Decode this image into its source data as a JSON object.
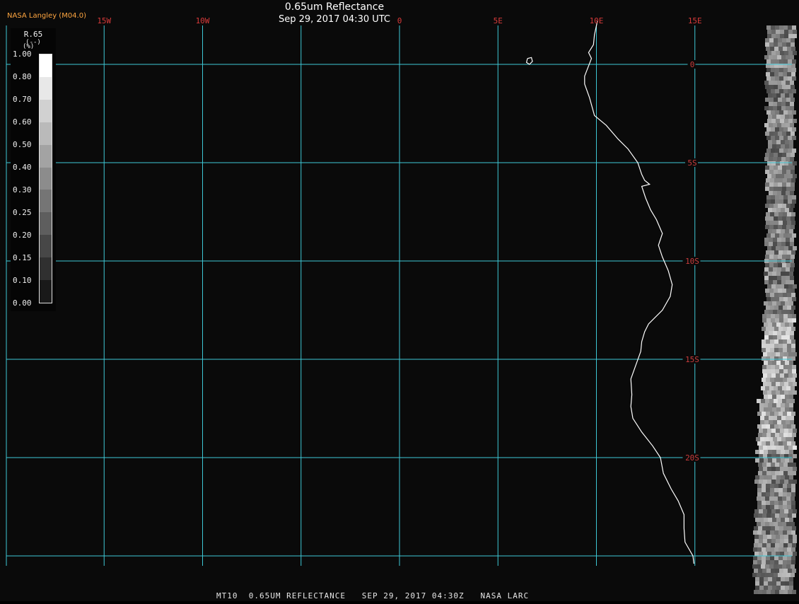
{
  "header": {
    "credit": "NASA Langley (M04.0)",
    "title": "0.65um Reflectance",
    "datetime": "Sep 29, 2017 04:30 UTC"
  },
  "footer": {
    "caption": "MT10  0.65UM REFLECTANCE   SEP 29, 2017 04:30Z   NASA LARC"
  },
  "legend": {
    "variable": "R.65",
    "units_line": "(--)",
    "units_prefix": "(%)",
    "ticks": [
      "1.00",
      "0.80",
      "0.70",
      "0.60",
      "0.50",
      "0.40",
      "0.30",
      "0.25",
      "0.20",
      "0.15",
      "0.10",
      "0.00"
    ],
    "min": 0.0,
    "max": 1.0
  },
  "map": {
    "lon_range": [
      -20,
      17
    ],
    "lat_range": [
      -25.3,
      1.9
    ],
    "lon_labels": [
      {
        "lon": -15,
        "text": "15W"
      },
      {
        "lon": -10,
        "text": "10W"
      },
      {
        "lon": -5,
        "text": ""
      },
      {
        "lon": 0,
        "text": "0"
      },
      {
        "lon": 5,
        "text": "5E"
      },
      {
        "lon": 10,
        "text": "10E"
      },
      {
        "lon": 15,
        "text": "15E"
      }
    ],
    "lat_labels": [
      {
        "lat": 0,
        "text": "0"
      },
      {
        "lat": -5,
        "text": "5S"
      },
      {
        "lat": -10,
        "text": "10S"
      },
      {
        "lat": -15,
        "text": "15S"
      },
      {
        "lat": -20,
        "text": "20S"
      },
      {
        "lat": -25,
        "text": ""
      }
    ],
    "coastline": [
      [
        10.05,
        2.2
      ],
      [
        9.9,
        1.5
      ],
      [
        9.85,
        1.0
      ],
      [
        9.6,
        0.6
      ],
      [
        9.75,
        0.3
      ],
      [
        9.4,
        -0.6
      ],
      [
        9.4,
        -1.0
      ],
      [
        9.65,
        -1.7
      ],
      [
        9.9,
        -2.6
      ],
      [
        10.5,
        -3.1
      ],
      [
        11.1,
        -3.8
      ],
      [
        11.6,
        -4.3
      ],
      [
        12.1,
        -5.0
      ],
      [
        12.3,
        -5.6
      ],
      [
        12.45,
        -5.9
      ],
      [
        12.7,
        -6.1
      ],
      [
        12.3,
        -6.2
      ],
      [
        12.5,
        -6.8
      ],
      [
        12.75,
        -7.4
      ],
      [
        13.05,
        -7.9
      ],
      [
        13.35,
        -8.6
      ],
      [
        13.15,
        -9.2
      ],
      [
        13.35,
        -9.8
      ],
      [
        13.65,
        -10.5
      ],
      [
        13.85,
        -11.2
      ],
      [
        13.75,
        -11.8
      ],
      [
        13.35,
        -12.5
      ],
      [
        12.65,
        -13.2
      ],
      [
        12.45,
        -13.6
      ],
      [
        12.3,
        -14.1
      ],
      [
        12.25,
        -14.6
      ],
      [
        12.0,
        -15.3
      ],
      [
        11.75,
        -16.0
      ],
      [
        11.8,
        -16.8
      ],
      [
        11.75,
        -17.4
      ],
      [
        11.85,
        -18.0
      ],
      [
        12.3,
        -18.7
      ],
      [
        12.85,
        -19.4
      ],
      [
        13.25,
        -20.0
      ],
      [
        13.4,
        -20.8
      ],
      [
        13.8,
        -21.6
      ],
      [
        14.15,
        -22.2
      ],
      [
        14.45,
        -22.9
      ],
      [
        14.45,
        -23.6
      ],
      [
        14.5,
        -24.3
      ],
      [
        14.9,
        -25.0
      ],
      [
        14.95,
        -25.4
      ]
    ],
    "island": [
      [
        6.5,
        0.3
      ],
      [
        6.7,
        0.35
      ],
      [
        6.75,
        0.15
      ],
      [
        6.6,
        0.0
      ],
      [
        6.45,
        0.1
      ],
      [
        6.5,
        0.3
      ]
    ]
  },
  "colors": {
    "ocean": "#0a0a0a",
    "grid": "#3ec8d6",
    "lon_label": "#d83a3a",
    "lat_label": "#c83c3c",
    "coast": "#ffffff",
    "credit": "#ffa640"
  }
}
